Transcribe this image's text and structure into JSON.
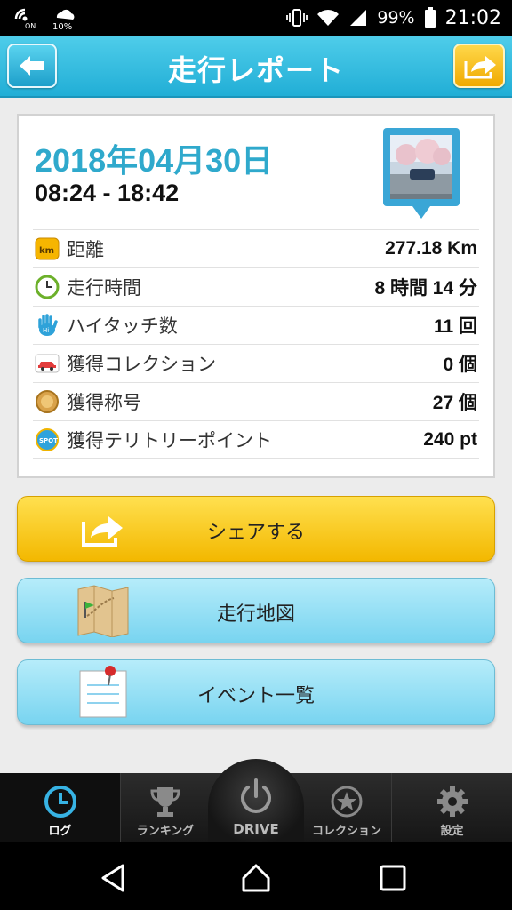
{
  "status_bar": {
    "battery": "99%",
    "time": "21:02",
    "notification_text": "10%"
  },
  "header": {
    "title": "走行レポート"
  },
  "report": {
    "date": "2018年04月30日",
    "time_range": "08:24 - 18:42",
    "rows": [
      {
        "icon": "km-icon",
        "label": "距離",
        "value": "277.18 Km"
      },
      {
        "icon": "clock-icon",
        "label": "走行時間",
        "value": "8 時間 14 分"
      },
      {
        "icon": "hand-icon",
        "label": "ハイタッチ数",
        "value": "11 回"
      },
      {
        "icon": "car-icon",
        "label": "獲得コレクション",
        "value": "0 個"
      },
      {
        "icon": "medal-icon",
        "label": "獲得称号",
        "value": "27 個"
      },
      {
        "icon": "spot-icon",
        "label": "獲得テリトリーポイント",
        "value": "240 pt"
      }
    ]
  },
  "buttons": {
    "share": "シェアする",
    "map": "走行地図",
    "events": "イベント一覧"
  },
  "tabs": {
    "log": "ログ",
    "ranking": "ランキング",
    "drive": "DRIVE",
    "collection": "コレクション",
    "settings": "設定"
  },
  "colors": {
    "header": "#21aed6",
    "date_text": "#2fa9cc",
    "share_button": "#f3b800",
    "nav_button": "#78d4f0"
  }
}
